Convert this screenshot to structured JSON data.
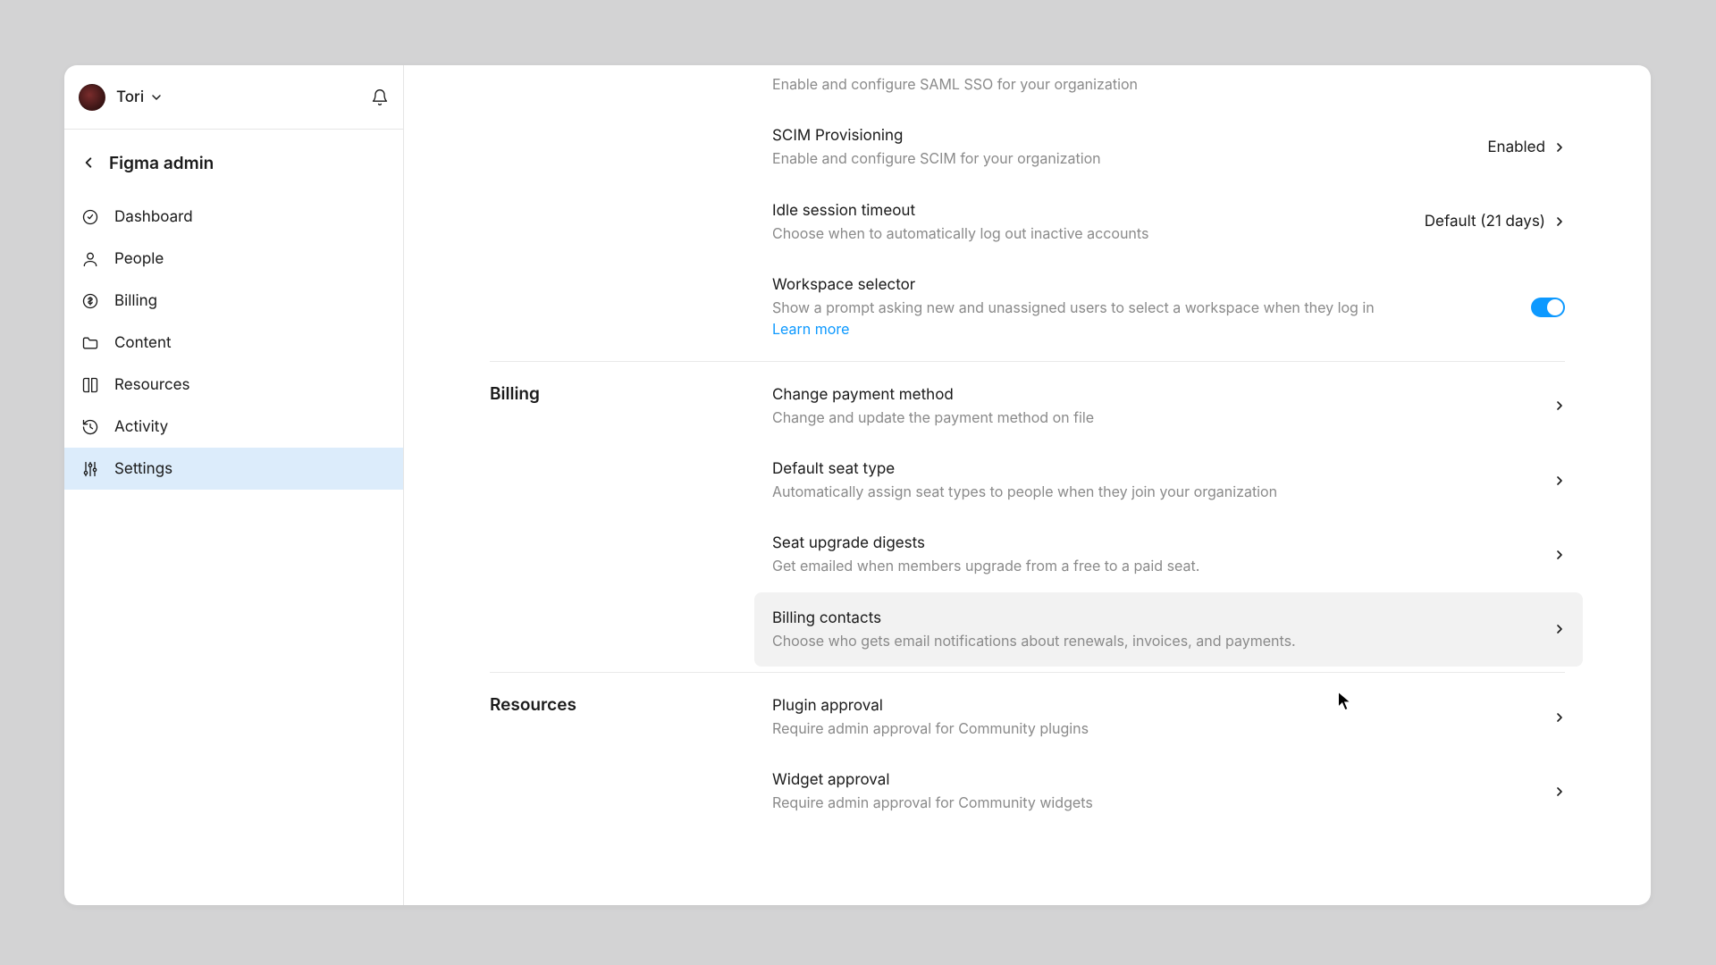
{
  "user": {
    "name": "Tori"
  },
  "admin_title": "Figma admin",
  "nav": {
    "items": [
      {
        "label": "Dashboard"
      },
      {
        "label": "People"
      },
      {
        "label": "Billing"
      },
      {
        "label": "Content"
      },
      {
        "label": "Resources"
      },
      {
        "label": "Activity"
      },
      {
        "label": "Settings"
      }
    ]
  },
  "sections": {
    "login": {
      "saml": {
        "desc": "Enable and configure SAML SSO for your organization"
      },
      "scim": {
        "title": "SCIM Provisioning",
        "desc": "Enable and configure SCIM for your organization",
        "status": "Enabled"
      },
      "idle": {
        "title": "Idle session timeout",
        "desc": "Choose when to automatically log out inactive accounts",
        "status": "Default (21 days)"
      },
      "workspace": {
        "title": "Workspace selector",
        "desc": "Show a prompt asking new and unassigned users to select a workspace when they log in",
        "link": "Learn more"
      }
    },
    "billing": {
      "title": "Billing",
      "payment": {
        "title": "Change payment method",
        "desc": "Change and update the payment method on file"
      },
      "seat_type": {
        "title": "Default seat type",
        "desc": "Automatically assign seat types to people when they join your organization"
      },
      "digests": {
        "title": "Seat upgrade digests",
        "desc": "Get emailed when members upgrade from a free to a paid seat."
      },
      "contacts": {
        "title": "Billing contacts",
        "desc": "Choose who gets email notifications about renewals, invoices, and payments."
      }
    },
    "resources": {
      "title": "Resources",
      "plugin": {
        "title": "Plugin approval",
        "desc": "Require admin approval for Community plugins"
      },
      "widget": {
        "title": "Widget approval",
        "desc": "Require admin approval for Community widgets"
      }
    }
  }
}
